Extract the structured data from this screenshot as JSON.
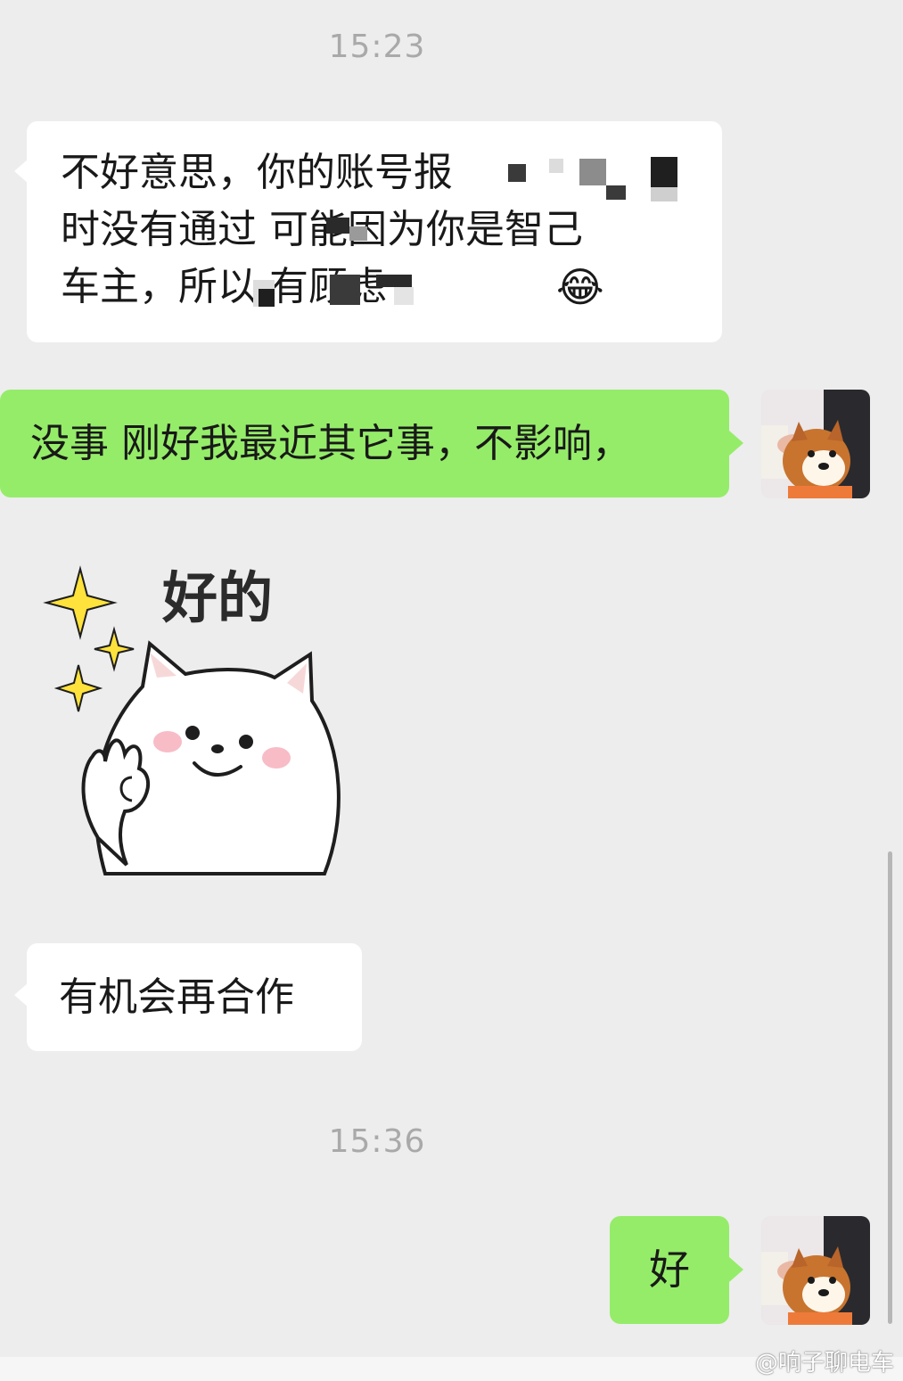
{
  "app": {
    "brand_green": "#95ec69",
    "bg": "#ededed"
  },
  "timestamps": [
    "15:23",
    "15:36"
  ],
  "messages": [
    {
      "side": "in",
      "text": "不好意思，你的账号报\n时没有通过   可能因为你是智己\n车主，所以        有顾虑",
      "emoji": "😂"
    },
    {
      "side": "out",
      "text": "没事 刚好我最近其它事，不影响，"
    },
    {
      "side": "in",
      "type": "sticker",
      "sticker_text": "好的"
    },
    {
      "side": "in",
      "text": "有机会再合作"
    },
    {
      "side": "out",
      "text": "好"
    }
  ],
  "avatar": {
    "icon": "shiba-dog-photo-avatar"
  },
  "watermark": "@响子聊电车"
}
